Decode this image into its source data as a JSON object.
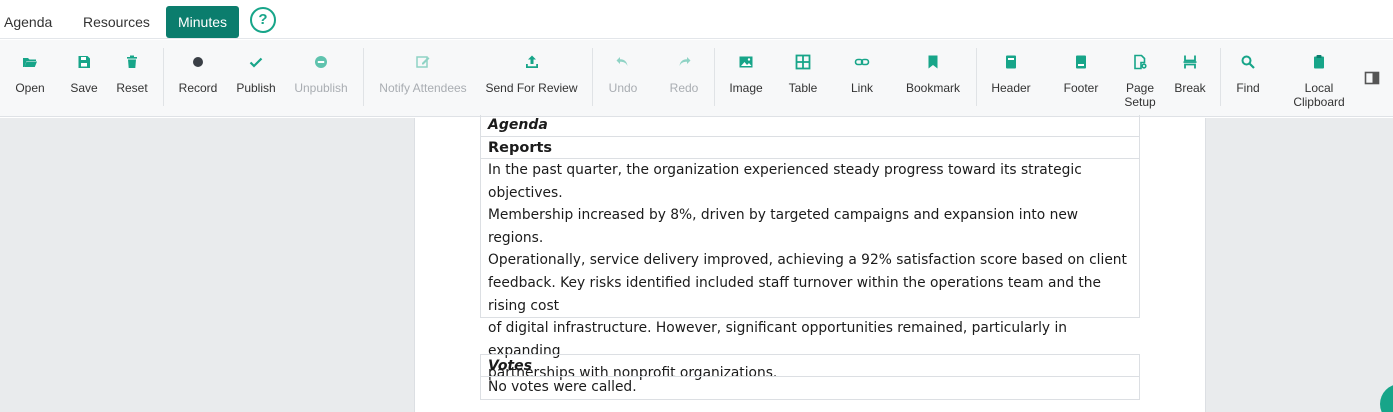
{
  "tabs": {
    "agenda": "Agenda",
    "resources": "Resources",
    "minutes": "Minutes",
    "help": "?"
  },
  "toolbar": {
    "open": "Open",
    "save": "Save",
    "reset": "Reset",
    "record": "Record",
    "publish": "Publish",
    "unpublish": "Unpublish",
    "notify_attendees": "Notify Attendees",
    "send_for_review": "Send For Review",
    "undo": "Undo",
    "redo": "Redo",
    "image": "Image",
    "table": "Table",
    "link": "Link",
    "bookmark": "Bookmark",
    "header": "Header",
    "footer": "Footer",
    "page_setup_line1": "Page",
    "page_setup_line2": "Setup",
    "break": "Break",
    "find": "Find",
    "local_clipboard_line1": "Local",
    "local_clipboard_line2": "Clipboard"
  },
  "document": {
    "agenda_heading": "Agenda",
    "reports_heading": "Reports",
    "reports_lines": [
      "In the past quarter, the organization experienced steady progress toward its strategic objectives.",
      "Membership increased by 8%, driven by targeted campaigns and expansion into new regions.",
      "Operationally, service delivery improved, achieving a 92% satisfaction score based on client",
      "feedback. Key risks identified included staff turnover within the operations team and the rising cost",
      "of digital infrastructure. However, significant opportunities remained, particularly in expanding",
      "partnerships with nonprofit organizations."
    ],
    "votes_heading": "Votes",
    "votes_body": "No votes were called."
  },
  "colors": {
    "accent": "#0b7d6d",
    "icon": "#17a589",
    "disabled": "#a9adb2"
  }
}
